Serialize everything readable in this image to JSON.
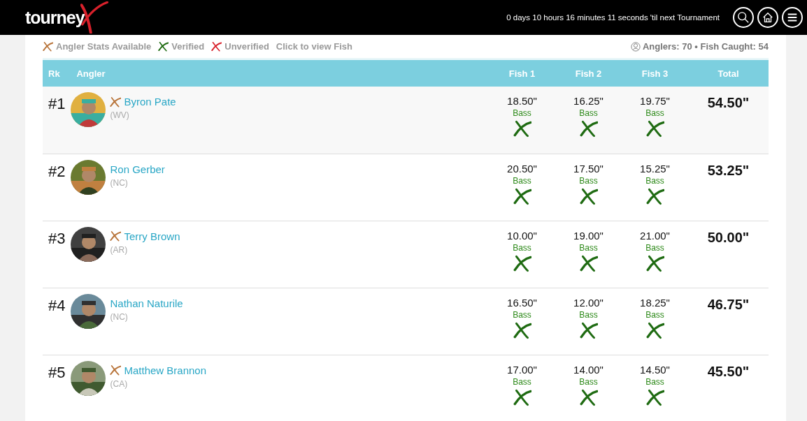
{
  "header": {
    "logo": "tourney",
    "countdown": "0 days 10 hours 16 minutes 11 seconds 'til next Tournament"
  },
  "legend": [
    {
      "kind": "stats",
      "label": "Angler Stats Available"
    },
    {
      "kind": "verified",
      "label": "Verified"
    },
    {
      "kind": "unverified",
      "label": "Unverified"
    },
    {
      "kind": "note",
      "label": "Click to view Fish"
    }
  ],
  "summary": "Anglers: 70 • Fish Caught: 54",
  "table": {
    "columns": [
      "Rk",
      "Angler",
      "Fish 1",
      "Fish 2",
      "Fish 3",
      "Total"
    ],
    "rows": [
      {
        "rank": "#1",
        "name": "Byron Pate",
        "state": "(WV)",
        "stats": true,
        "highlighted": true,
        "fish": [
          {
            "length": "18.50\"",
            "species": "Bass",
            "verified": true
          },
          {
            "length": "16.25\"",
            "species": "Bass",
            "verified": true
          },
          {
            "length": "19.75\"",
            "species": "Bass",
            "verified": true
          }
        ],
        "total": "54.50\""
      },
      {
        "rank": "#2",
        "name": "Ron Gerber",
        "state": "(NC)",
        "stats": false,
        "highlighted": false,
        "fish": [
          {
            "length": "20.50\"",
            "species": "Bass",
            "verified": true
          },
          {
            "length": "17.50\"",
            "species": "Bass",
            "verified": true
          },
          {
            "length": "15.25\"",
            "species": "Bass",
            "verified": true
          }
        ],
        "total": "53.25\""
      },
      {
        "rank": "#3",
        "name": "Terry Brown",
        "state": "(AR)",
        "stats": true,
        "highlighted": false,
        "fish": [
          {
            "length": "10.00\"",
            "species": "Bass",
            "verified": true
          },
          {
            "length": "19.00\"",
            "species": "Bass",
            "verified": true
          },
          {
            "length": "21.00\"",
            "species": "Bass",
            "verified": true
          }
        ],
        "total": "50.00\""
      },
      {
        "rank": "#4",
        "name": "Nathan Naturile",
        "state": "(NC)",
        "stats": false,
        "highlighted": false,
        "fish": [
          {
            "length": "16.50\"",
            "species": "Bass",
            "verified": true
          },
          {
            "length": "12.00\"",
            "species": "Bass",
            "verified": true
          },
          {
            "length": "18.25\"",
            "species": "Bass",
            "verified": true
          }
        ],
        "total": "46.75\""
      },
      {
        "rank": "#5",
        "name": "Matthew Brannon",
        "state": "(CA)",
        "stats": true,
        "highlighted": false,
        "fish": [
          {
            "length": "17.00\"",
            "species": "Bass",
            "verified": true
          },
          {
            "length": "14.00\"",
            "species": "Bass",
            "verified": true
          },
          {
            "length": "14.50\"",
            "species": "Bass",
            "verified": true
          }
        ],
        "total": "45.50\""
      }
    ]
  }
}
